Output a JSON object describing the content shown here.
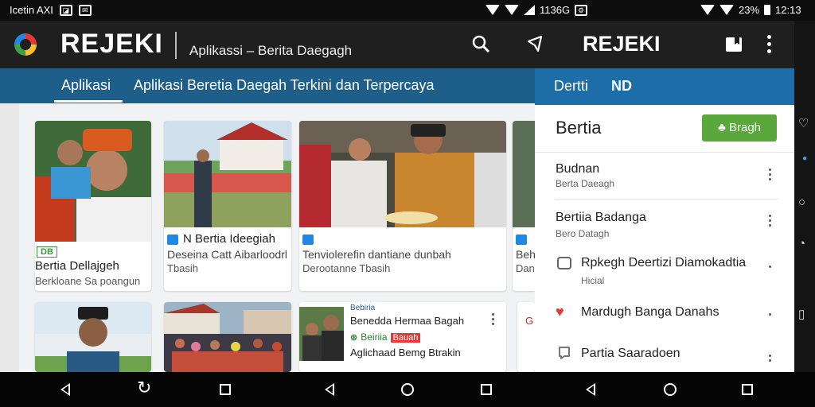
{
  "status_bar": {
    "left_text": "Icetin AXI",
    "mid_text": "1136G",
    "battery": "23%",
    "time": "12:13"
  },
  "app_bar": {
    "brand": "REJEKI",
    "subtitle": "Aplikassi – Berita Daegagh",
    "brand_right": "REJEKI"
  },
  "tabs": [
    {
      "label": "Aplikasi"
    },
    {
      "label": "Aplikasi Beretia Daegah Terkini dan Terpercaya"
    }
  ],
  "cards": [
    {
      "title": "Bertia Dellajgeh",
      "meta": "Berkloane Sa poangun",
      "badge": "DB"
    },
    {
      "title": "N Bertia Ideegiah",
      "sub": "Deseina Catt Aibarloodrl",
      "meta": "Tbasih"
    },
    {
      "title": "Tenviolerefin dantiane dunbah",
      "meta": "Derootanne Tbasih"
    },
    {
      "title": "Beh",
      "meta": "Dan"
    },
    {
      "title": "Benedda Hermaa Bagah",
      "sub": "Aglichaad Bemg Btrakin",
      "sup": "Bebiria",
      "badge": "Beiriia",
      "red": "Bauah"
    }
  ],
  "drawer": {
    "header_left": "Dertti",
    "header_right": "ND",
    "title": "Bertia",
    "button": "Bragh",
    "items": [
      {
        "title": "Budnan",
        "sub": "Berta Daeagh"
      },
      {
        "title": "Bertiia Badanga",
        "sub": "Bero Datagh"
      },
      {
        "title": "Rpkegh Deertizi Diamokadtia",
        "sub": "Hicial"
      },
      {
        "title": "Mardugh Banga Danahs",
        "sub": ""
      },
      {
        "title": "Partia Saaradoen",
        "sub": ""
      }
    ]
  },
  "colors": {
    "tab_blue": "#1d5e8a",
    "drawer_header": "#1d6ea8",
    "button_green": "#5aa83c",
    "heart_red": "#e53935"
  }
}
